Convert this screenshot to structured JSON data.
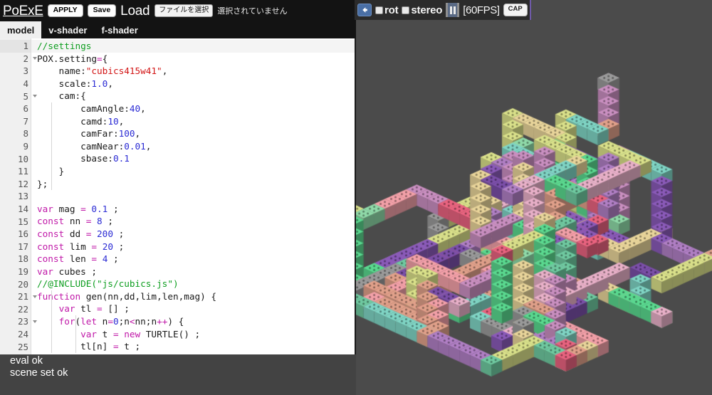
{
  "topbar": {
    "app_title": "PoExE",
    "apply_label": "APPLY",
    "save_label": "Save",
    "load_label": "Load",
    "file_button_label": "ファイルを選択",
    "file_status_label": "選択されていません"
  },
  "tabs": [
    {
      "label": "model",
      "active": true
    },
    {
      "label": "v-shader",
      "active": false
    },
    {
      "label": "f-shader",
      "active": false
    }
  ],
  "editor": {
    "active_line": 1,
    "fold_lines": [
      2,
      5,
      21,
      23
    ],
    "lines": [
      {
        "n": 1,
        "html": "<span class=\"com\">//settings</span>"
      },
      {
        "n": 2,
        "html": "POX.setting<span class=\"kw\">=</span>{"
      },
      {
        "n": 3,
        "html": "    name:<span class=\"str\">\"cubics415w41\"</span>,"
      },
      {
        "n": 4,
        "html": "    scale:<span class=\"num\">1.0</span>,"
      },
      {
        "n": 5,
        "html": "    cam:{"
      },
      {
        "n": 6,
        "html": "        camAngle:<span class=\"num\">40</span>,"
      },
      {
        "n": 7,
        "html": "        camd:<span class=\"num\">10</span>,"
      },
      {
        "n": 8,
        "html": "        camFar:<span class=\"num\">100</span>,"
      },
      {
        "n": 9,
        "html": "        camNear:<span class=\"num\">0.01</span>,"
      },
      {
        "n": 10,
        "html": "        sbase:<span class=\"num\">0.1</span>"
      },
      {
        "n": 11,
        "html": "    }"
      },
      {
        "n": 12,
        "html": "};"
      },
      {
        "n": 13,
        "html": ""
      },
      {
        "n": 14,
        "html": "<span class=\"kw\">var</span> mag <span class=\"kw\">=</span> <span class=\"num\">0.1</span> ;"
      },
      {
        "n": 15,
        "html": "<span class=\"kw\">const</span> nn <span class=\"kw\">=</span> <span class=\"num\">8</span> ;"
      },
      {
        "n": 16,
        "html": "<span class=\"kw\">const</span> dd <span class=\"kw\">=</span> <span class=\"num\">200</span> ;"
      },
      {
        "n": 17,
        "html": "<span class=\"kw\">const</span> lim <span class=\"kw\">=</span> <span class=\"num\">20</span> ;"
      },
      {
        "n": 18,
        "html": "<span class=\"kw\">const</span> len <span class=\"kw\">=</span> <span class=\"num\">4</span> ;"
      },
      {
        "n": 19,
        "html": "<span class=\"kw\">var</span> cubes ;"
      },
      {
        "n": 20,
        "html": "<span class=\"com\">//@INCLUDE(\"js/cubics.js\")</span>"
      },
      {
        "n": 21,
        "html": "<span class=\"kw\">function</span> gen(nn,dd,lim,len,mag) {"
      },
      {
        "n": 22,
        "html": "    <span class=\"kw\">var</span> tl <span class=\"kw\">=</span> [] ;"
      },
      {
        "n": 23,
        "html": "    <span class=\"kw\">for</span>(<span class=\"kw\">let</span> n<span class=\"kw\">=</span><span class=\"num\">0</span>;n<span class=\"kw\">&lt;</span>nn;n<span class=\"kw\">++</span>) {"
      },
      {
        "n": 24,
        "html": "        <span class=\"kw\">var</span> t <span class=\"kw\">=</span> <span class=\"kw\">new</span> TURTLE() ;"
      },
      {
        "n": 25,
        "html": "        tl[n] <span class=\"kw\">=</span> t ;"
      }
    ]
  },
  "console": {
    "lines": [
      "eval ok",
      "scene set ok"
    ]
  },
  "render_controls": {
    "back_icon": "arrow-left-icon",
    "rot_label": "rot",
    "rot_checked": false,
    "stereo_label": "stereo",
    "stereo_checked": false,
    "pause_icon": "pause-icon",
    "fps_label": "[60FPS]",
    "cap_label": "CAP"
  },
  "viewport": {
    "background_color": "#4b4b4b",
    "description": "3D scene of interlocking colored cube lattice beams",
    "palette": [
      "#e8d49a",
      "#8fd9a8",
      "#b07fc4",
      "#e8637f",
      "#7fd4c4",
      "#d9e08a",
      "#e0a08a",
      "#7b4fa8",
      "#5ad88f",
      "#c98fc0",
      "#9a9a9a",
      "#e8b0c8",
      "#6fc9a0",
      "#f2a0a8",
      "#8a5ab8"
    ]
  }
}
